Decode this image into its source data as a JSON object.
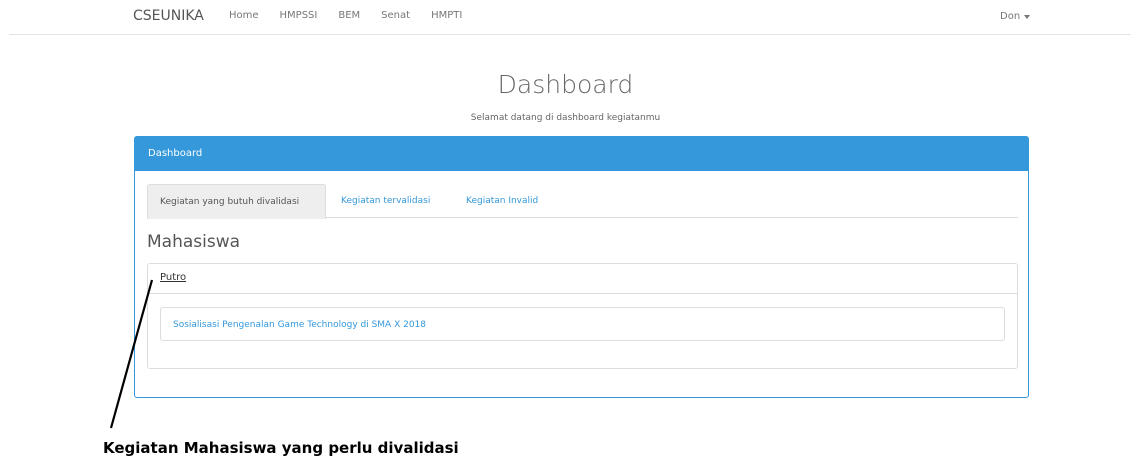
{
  "navbar": {
    "brand": "CSEUNIKA",
    "links": [
      "Home",
      "HMPSSI",
      "BEM",
      "Senat",
      "HMPTI"
    ],
    "user": "Don"
  },
  "header": {
    "title": "Dashboard",
    "subtitle": "Selamat datang di dashboard kegiatanmu"
  },
  "panel": {
    "heading": "Dashboard",
    "tabs": [
      {
        "label": "Kegiatan yang butuh divalidasi",
        "active": true
      },
      {
        "label": "Kegiatan tervalidasi",
        "active": false
      },
      {
        "label": "Kegiatan Invalid",
        "active": false
      }
    ],
    "section_title": "Mahasiswa",
    "student": {
      "name": "Putro",
      "activities": [
        "Sosialisasi Pengenalan Game Technology di SMA X 2018"
      ]
    }
  },
  "annotation": {
    "text": "Kegiatan Mahasiswa yang perlu divalidasi"
  },
  "colors": {
    "accent": "#3498db",
    "border": "#dddddd"
  }
}
